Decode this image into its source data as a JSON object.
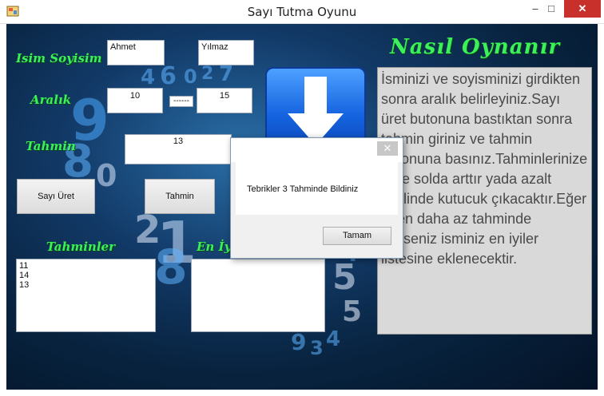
{
  "window": {
    "title": "Sayı Tutma Oyunu",
    "minimize": "–",
    "maximize": "□",
    "close": "✕"
  },
  "labels": {
    "isim_soyisim": "Isim Soyisim",
    "aralik": "Aralık",
    "tahmin": "Tahmin",
    "tahminler": "Tahminler",
    "en_iyiler": "En İy",
    "nasil_oynanir": "Nasıl Oynanır"
  },
  "inputs": {
    "ad": "Ahmet",
    "soyad": "Yılmaz",
    "aralik_min": "10",
    "aralik_sep": "------",
    "aralik_max": "15",
    "tahmin": "13"
  },
  "buttons": {
    "sayi_uret": "Sayı Üret",
    "tahmin": "Tahmin"
  },
  "tahminler_list": "11\n14\n13",
  "howto_text": "İsminizi ve soyisminizi girdikten sonra aralık belirleyiniz.Sayı üret butonuna bastıktan sonra tahmin giriniz ve tahmin butonuna basınız.Tahminlerinize göre solda arttır yada azalt şeklinde kutucuk çıkacaktır.Eğer 5 ten daha az tahminde bilirseniz isminiz en iyiler listesine eklenecektir.",
  "dialog": {
    "message": "Tebrikler 3 Tahminde Bildiniz",
    "ok": "Tamam",
    "close": "✕"
  },
  "background_digits": [
    "4",
    "6",
    "0",
    "2",
    "7",
    "5",
    "9",
    "8",
    "1",
    "3",
    "6",
    "8",
    "5",
    "0",
    "7",
    "3",
    "2",
    "4",
    "9",
    "8"
  ],
  "colors": {
    "accent_green": "#3cf05a",
    "arrow_blue": "#1563e0",
    "close_red": "#c7302b"
  }
}
